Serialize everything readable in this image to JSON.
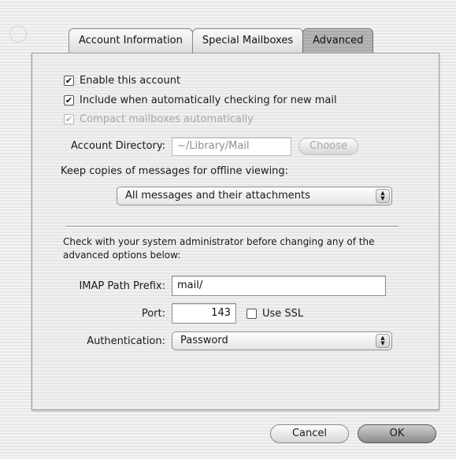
{
  "tabs": [
    {
      "label": "Account Information",
      "active": false
    },
    {
      "label": "Special Mailboxes",
      "active": false
    },
    {
      "label": "Advanced",
      "active": true
    }
  ],
  "options": {
    "enable_account": {
      "label": "Enable this account",
      "checked": true
    },
    "include_check": {
      "label": "Include when automatically checking for new mail",
      "checked": true
    },
    "compact": {
      "label": "Compact mailboxes automatically",
      "checked": true,
      "enabled": false
    }
  },
  "account_directory": {
    "label": "Account Directory:",
    "value": "~/Library/Mail",
    "choose_label": "Choose"
  },
  "offline": {
    "label": "Keep copies of messages for offline viewing:",
    "selected": "All messages and their attachments"
  },
  "admin_note": "Check with your system administrator before changing any of the advanced options below:",
  "imap_prefix": {
    "label": "IMAP Path Prefix:",
    "value": "mail/"
  },
  "port": {
    "label": "Port:",
    "value": "143",
    "ssl_label": "Use SSL",
    "ssl_checked": false
  },
  "authentication": {
    "label": "Authentication:",
    "selected": "Password"
  },
  "buttons": {
    "cancel": "Cancel",
    "ok": "OK"
  }
}
